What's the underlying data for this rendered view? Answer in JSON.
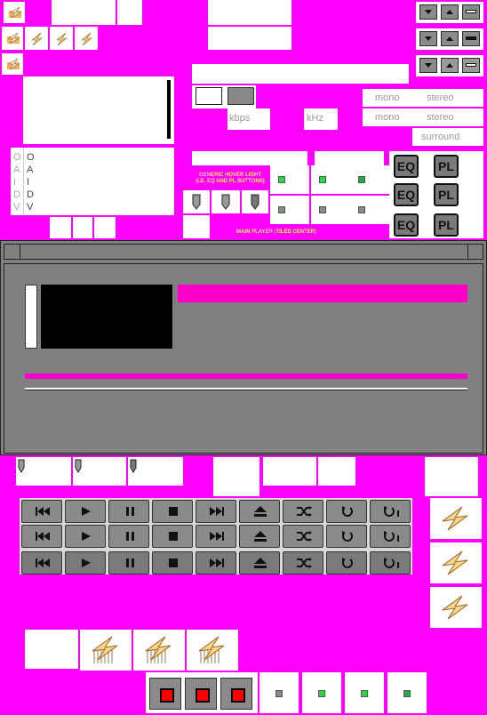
{
  "labels": {
    "kbps": "kbps",
    "khz": "kHz",
    "mono1": "mono",
    "stereo1": "stereo",
    "mono2": "mono",
    "stereo2": "stereo",
    "surround": "surround",
    "hover_caption_line1": "GENERIC HOVER LIGHT",
    "hover_caption_line2": "(I.E. EQ AND PL BUTTONS)",
    "main_caption": "MAIN PLAYER (TILED CENTER)",
    "eq1": "EQ",
    "eq2": "EQ",
    "eq3": "EQ",
    "pl1": "PL",
    "pl2": "PL",
    "pl3": "PL",
    "oaidv_col1": [
      "O",
      "A",
      "I",
      "D",
      "V"
    ],
    "oaidv_col2": [
      "O",
      "A",
      "I",
      "D",
      "V"
    ]
  },
  "colors": {
    "background": "#ff00ff",
    "panel": "#808080",
    "accent_bar": "#ff00cc",
    "display": "#000000",
    "button_gray": "#8a8a8a",
    "led_green": "#00cc33"
  },
  "icons": {
    "transport": [
      "prev-icon",
      "play-icon",
      "pause-icon",
      "stop-icon",
      "next-icon",
      "eject-icon",
      "shuffle-icon",
      "repeat-icon",
      "repeat-one-icon"
    ],
    "logo": "winamp-lightning-icon"
  }
}
